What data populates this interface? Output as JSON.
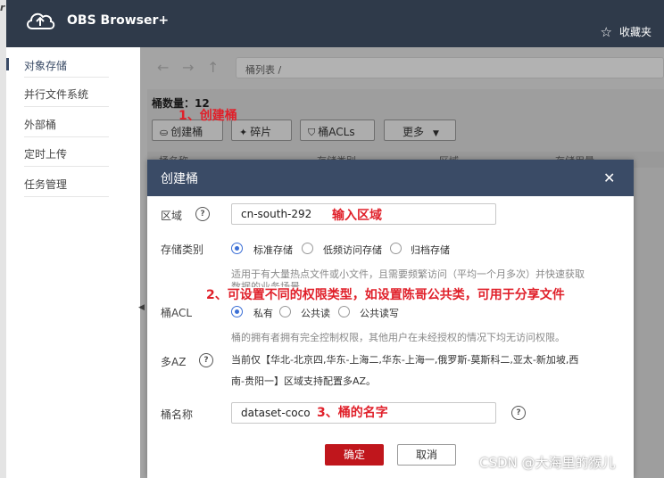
{
  "app": {
    "title": "OBS Browser+",
    "corner": "r",
    "favorites": "收藏夹"
  },
  "sidebar": {
    "items": [
      {
        "label": "对象存储",
        "active": true
      },
      {
        "label": "并行文件系统"
      },
      {
        "label": "外部桶"
      },
      {
        "label": "定时上传"
      },
      {
        "label": "任务管理"
      }
    ]
  },
  "nav": {
    "breadcrumb": "桶列表 /"
  },
  "main": {
    "bucket_count": "桶数量：12",
    "toolbar": {
      "create": "创建桶",
      "fragments": "碎片",
      "acls": "桶ACLs",
      "more": "更多"
    },
    "columns": [
      "桶名称",
      "存储类别",
      "区域",
      "存储用量"
    ]
  },
  "annotations": {
    "a1": "1、创建桶",
    "a2": "输入区域",
    "a3": "2、可设置不同的权限类型，如设置陈哥公共类，可用于分享文件",
    "a4": "3、桶的名字"
  },
  "modal": {
    "title": "创建桶",
    "region_label": "区域",
    "region_value": "cn-south-292",
    "storage_label": "存储类别",
    "storage_options": [
      "标准存储",
      "低频访问存储",
      "归档存储"
    ],
    "storage_desc_1": "适用于有大量热点文件或小文件，且需要频繁访问（平均一个月多次）并快速获取",
    "storage_desc_2": "数据的业务场景",
    "acl_label": "桶ACL",
    "acl_options": [
      "私有",
      "公共读",
      "公共读写"
    ],
    "acl_desc": "桶的拥有者拥有完全控制权限，其他用户在未经授权的情况下均无访问权限。",
    "az_label": "多AZ",
    "az_text_1": "当前仅【华北-北京四,华东-上海二,华东-上海一,俄罗斯-莫斯科二,亚太-新加坡,西",
    "az_text_2": "南-贵阳一】区域支持配置多AZ。",
    "name_label": "桶名称",
    "name_value": "dataset-coco",
    "ok": "确定",
    "cancel": "取消"
  },
  "watermark": "CSDN @大海里的猴儿",
  "colors": {
    "header": "#2f3a4a",
    "modal_header": "#3a4b66",
    "ok_button": "#c0161c",
    "annotation": "#e0202a",
    "radio": "#3b6fd6"
  }
}
